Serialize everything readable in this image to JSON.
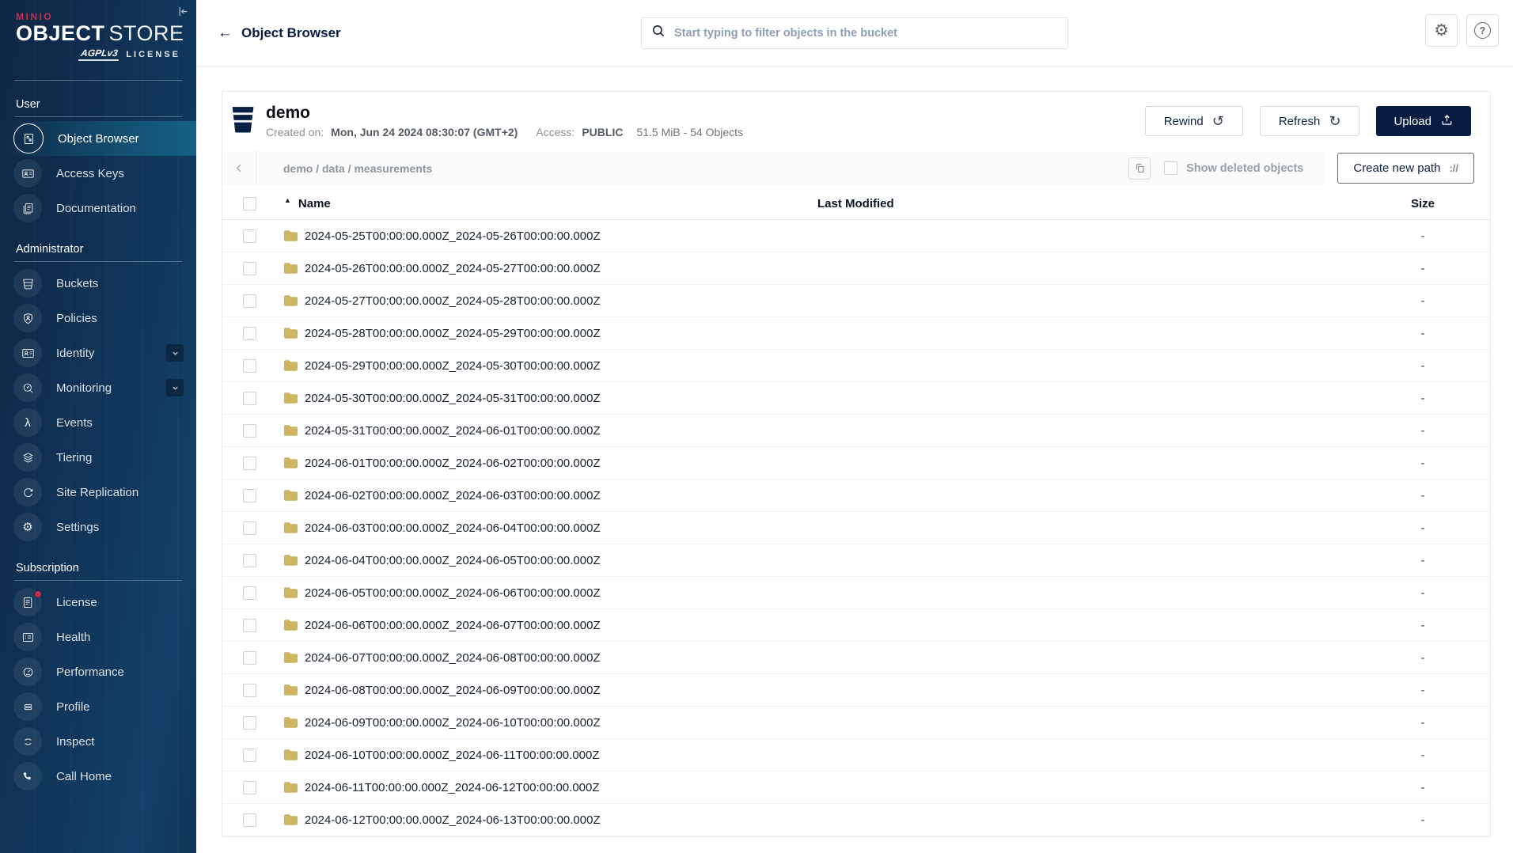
{
  "brand": {
    "minio": "MINIO",
    "object": "OBJECT",
    "store": "STORE",
    "badge": "AGPLv3",
    "license": "LICENSE"
  },
  "topbar": {
    "title": "Object Browser",
    "search_placeholder": "Start typing to filter objects in the bucket"
  },
  "sidebar": {
    "sections": [
      {
        "label": "User",
        "items": [
          {
            "label": "Object Browser"
          },
          {
            "label": "Access Keys"
          },
          {
            "label": "Documentation"
          }
        ]
      },
      {
        "label": "Administrator",
        "items": [
          {
            "label": "Buckets"
          },
          {
            "label": "Policies"
          },
          {
            "label": "Identity"
          },
          {
            "label": "Monitoring"
          },
          {
            "label": "Events"
          },
          {
            "label": "Tiering"
          },
          {
            "label": "Site Replication"
          },
          {
            "label": "Settings"
          }
        ]
      },
      {
        "label": "Subscription",
        "items": [
          {
            "label": "License"
          },
          {
            "label": "Health"
          },
          {
            "label": "Performance"
          },
          {
            "label": "Profile"
          },
          {
            "label": "Inspect"
          },
          {
            "label": "Call Home"
          }
        ]
      }
    ]
  },
  "bucket_header": {
    "name": "demo",
    "created_label": "Created on:",
    "created_value": "Mon, Jun 24 2024 08:30:07 (GMT+2)",
    "access_label": "Access:",
    "access_value": "PUBLIC",
    "stats": "51.5 MiB - 54 Objects",
    "rewind": "Rewind",
    "refresh": "Refresh",
    "upload": "Upload"
  },
  "browser_bar": {
    "path": "demo / data / measurements",
    "show_deleted": "Show deleted objects",
    "create_path": "Create new path",
    "create_path_icon": "://"
  },
  "table": {
    "name_col": "Name",
    "modified_col": "Last Modified",
    "size_col": "Size",
    "sort_icon": "▲",
    "rows": [
      {
        "name": "2024-05-25T00:00:00.000Z_2024-05-26T00:00:00.000Z",
        "size": "-"
      },
      {
        "name": "2024-05-26T00:00:00.000Z_2024-05-27T00:00:00.000Z",
        "size": "-"
      },
      {
        "name": "2024-05-27T00:00:00.000Z_2024-05-28T00:00:00.000Z",
        "size": "-"
      },
      {
        "name": "2024-05-28T00:00:00.000Z_2024-05-29T00:00:00.000Z",
        "size": "-"
      },
      {
        "name": "2024-05-29T00:00:00.000Z_2024-05-30T00:00:00.000Z",
        "size": "-"
      },
      {
        "name": "2024-05-30T00:00:00.000Z_2024-05-31T00:00:00.000Z",
        "size": "-"
      },
      {
        "name": "2024-05-31T00:00:00.000Z_2024-06-01T00:00:00.000Z",
        "size": "-"
      },
      {
        "name": "2024-06-01T00:00:00.000Z_2024-06-02T00:00:00.000Z",
        "size": "-"
      },
      {
        "name": "2024-06-02T00:00:00.000Z_2024-06-03T00:00:00.000Z",
        "size": "-"
      },
      {
        "name": "2024-06-03T00:00:00.000Z_2024-06-04T00:00:00.000Z",
        "size": "-"
      },
      {
        "name": "2024-06-04T00:00:00.000Z_2024-06-05T00:00:00.000Z",
        "size": "-"
      },
      {
        "name": "2024-06-05T00:00:00.000Z_2024-06-06T00:00:00.000Z",
        "size": "-"
      },
      {
        "name": "2024-06-06T00:00:00.000Z_2024-06-07T00:00:00.000Z",
        "size": "-"
      },
      {
        "name": "2024-06-07T00:00:00.000Z_2024-06-08T00:00:00.000Z",
        "size": "-"
      },
      {
        "name": "2024-06-08T00:00:00.000Z_2024-06-09T00:00:00.000Z",
        "size": "-"
      },
      {
        "name": "2024-06-09T00:00:00.000Z_2024-06-10T00:00:00.000Z",
        "size": "-"
      },
      {
        "name": "2024-06-10T00:00:00.000Z_2024-06-11T00:00:00.000Z",
        "size": "-"
      },
      {
        "name": "2024-06-11T00:00:00.000Z_2024-06-12T00:00:00.000Z",
        "size": "-"
      },
      {
        "name": "2024-06-12T00:00:00.000Z_2024-06-13T00:00:00.000Z",
        "size": "-"
      }
    ]
  },
  "icons": {
    "lambda": "λ",
    "gear": "⚙",
    "help": "?",
    "rewind": "↺",
    "refresh": "↻",
    "back_arrow": "←"
  },
  "colors": {
    "brand_red": "#c72c48",
    "navy": "#081c42",
    "selected_teal": "#156181",
    "folder": "#cfb55f"
  }
}
